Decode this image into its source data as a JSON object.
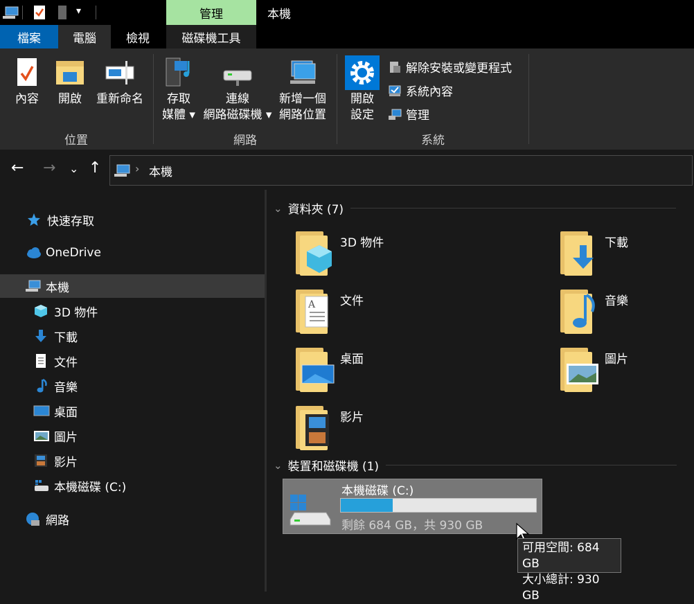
{
  "window": {
    "title": "本機",
    "context_group": "管理"
  },
  "tabs": [
    "檔案",
    "電腦",
    "檢視",
    "磁碟機工具"
  ],
  "ribbon": {
    "location": {
      "label": "位置",
      "buttons": [
        "內容",
        "開啟",
        "重新命名"
      ]
    },
    "network": {
      "label": "網路",
      "buttons": [
        {
          "line1": "存取",
          "line2": "媒體 ▾"
        },
        {
          "line1": "連線",
          "line2": "網路磁碟機 ▾"
        },
        {
          "line1": "新增一個",
          "line2": "網路位置"
        }
      ]
    },
    "system": {
      "label": "系統",
      "open_settings": {
        "line1": "開啟",
        "line2": "設定"
      },
      "items": [
        "解除安裝或變更程式",
        "系統內容",
        "管理"
      ]
    }
  },
  "address": {
    "location": "本機"
  },
  "sidebar": {
    "quick_access": "快速存取",
    "onedrive": "OneDrive",
    "this_pc": "本機",
    "children": [
      "3D 物件",
      "下載",
      "文件",
      "音樂",
      "桌面",
      "圖片",
      "影片",
      "本機磁碟 (C:)"
    ],
    "network": "網路"
  },
  "content": {
    "folders_header": "資料夾 (7)",
    "folders": [
      "3D 物件",
      "下載",
      "文件",
      "音樂",
      "桌面",
      "圖片",
      "影片"
    ],
    "devices_header": "裝置和磁碟機 (1)",
    "drive": {
      "name": "本機磁碟 (C:)",
      "free_text": "剩餘 684 GB，共 930 GB",
      "used_fraction": 0.265
    }
  },
  "tooltip": {
    "line1": "可用空間: 684 GB",
    "line2": "大小總計: 930 GB"
  },
  "colors": {
    "accent": "#0063b1",
    "context_tab": "#a6e3a1",
    "progress": "#26a0da"
  }
}
